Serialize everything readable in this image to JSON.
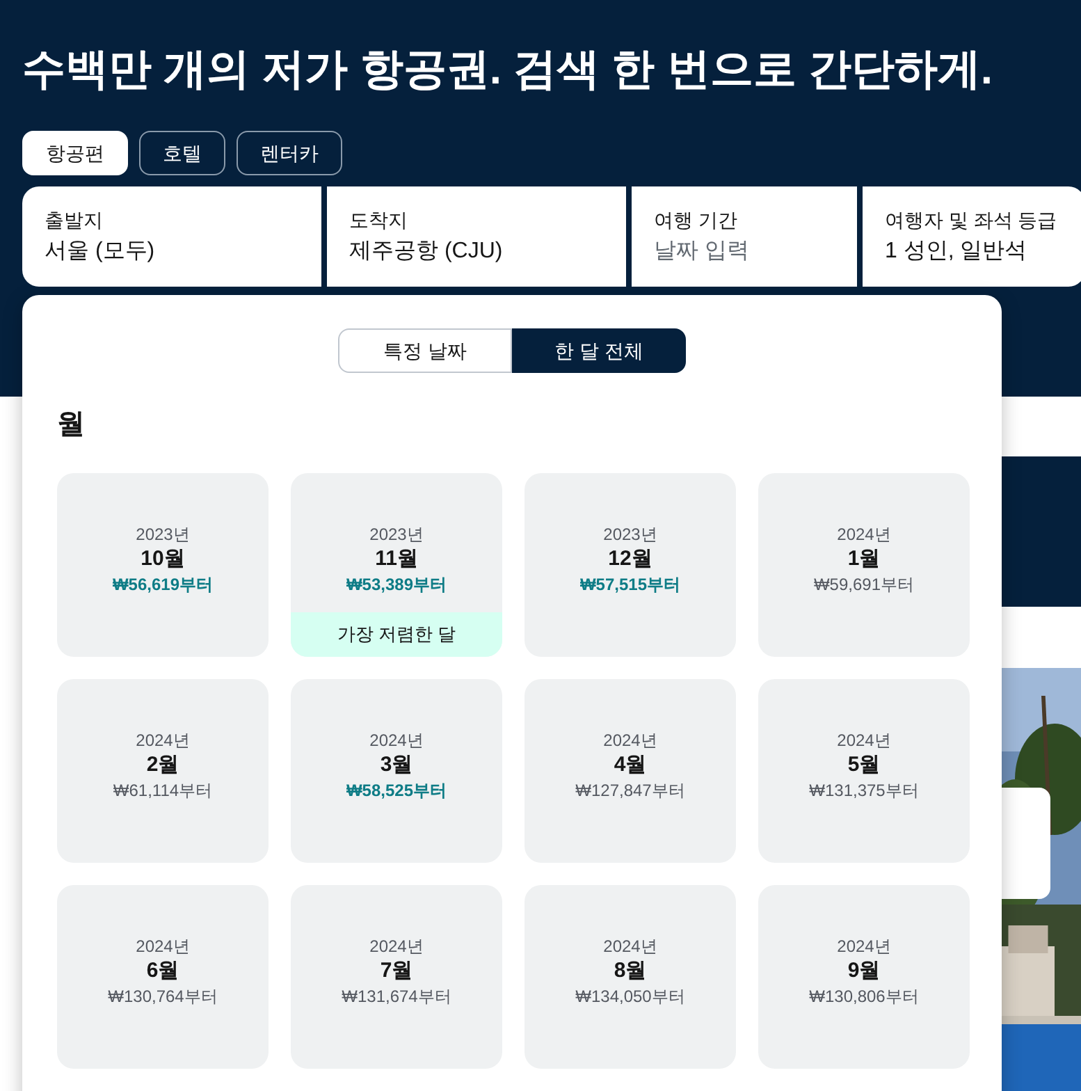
{
  "headline": "수백만 개의 저가 항공권. 검색 한 번으로 간단하게.",
  "tabs": [
    {
      "label": "항공편",
      "selected": true
    },
    {
      "label": "호텔",
      "selected": false
    },
    {
      "label": "렌터카",
      "selected": false
    }
  ],
  "search_fields": [
    {
      "label": "출발지",
      "value": "서울 (모두)"
    },
    {
      "label": "도착지",
      "value": "제주공항 (CJU)"
    },
    {
      "label": "여행 기간",
      "placeholder": "날짜 입력"
    },
    {
      "label": "여행자 및 좌석 등급",
      "value": "1 성인, 일반석"
    }
  ],
  "date_picker": {
    "modes": [
      {
        "label": "특정 날짜",
        "selected": false
      },
      {
        "label": "한 달 전체",
        "selected": true
      }
    ],
    "heading": "월",
    "months": [
      {
        "year": "2023년",
        "month": "10월",
        "price": "₩56,619부터",
        "highlighted": true
      },
      {
        "year": "2023년",
        "month": "11월",
        "price": "₩53,389부터",
        "highlighted": true,
        "badge": "가장 저렴한 달"
      },
      {
        "year": "2023년",
        "month": "12월",
        "price": "₩57,515부터",
        "highlighted": true
      },
      {
        "year": "2024년",
        "month": "1월",
        "price": "₩59,691부터",
        "highlighted": false
      },
      {
        "year": "2024년",
        "month": "2월",
        "price": "₩61,114부터",
        "highlighted": false
      },
      {
        "year": "2024년",
        "month": "3월",
        "price": "₩58,525부터",
        "highlighted": true
      },
      {
        "year": "2024년",
        "month": "4월",
        "price": "₩127,847부터",
        "highlighted": false
      },
      {
        "year": "2024년",
        "month": "5월",
        "price": "₩131,375부터",
        "highlighted": false
      },
      {
        "year": "2024년",
        "month": "6월",
        "price": "₩130,764부터",
        "highlighted": false
      },
      {
        "year": "2024년",
        "month": "7월",
        "price": "₩131,674부터",
        "highlighted": false
      },
      {
        "year": "2024년",
        "month": "8월",
        "price": "₩134,050부터",
        "highlighted": false
      },
      {
        "year": "2024년",
        "month": "9월",
        "price": "₩130,806부터",
        "highlighted": false
      }
    ]
  }
}
